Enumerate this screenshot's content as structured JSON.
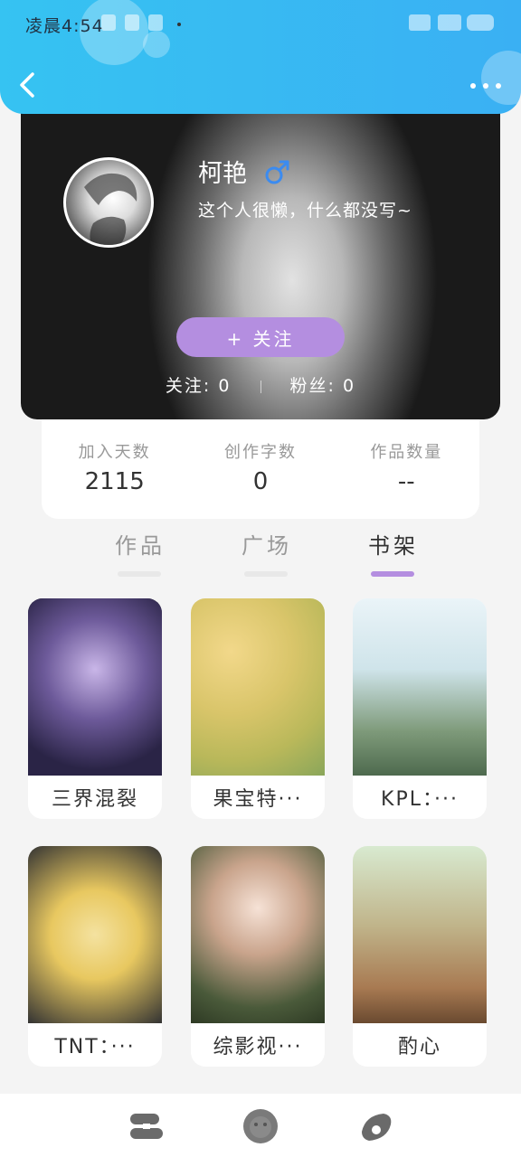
{
  "status_bar": {
    "time": "凌晨4:54"
  },
  "header": {
    "back_icon": "chevron-left-icon",
    "more_icon": "more-dots-icon"
  },
  "profile": {
    "username": "柯艳",
    "gender_icon": "male-icon",
    "bio": "这个人很懒，什么都没写~",
    "follow_button": "+ 关注",
    "following_label": "关注:",
    "following_count": "0",
    "followers_label": "粉丝:",
    "followers_count": "0"
  },
  "stats": [
    {
      "label": "加入天数",
      "value": "2115"
    },
    {
      "label": "创作字数",
      "value": "0"
    },
    {
      "label": "作品数量",
      "value": "--"
    }
  ],
  "tabs": [
    {
      "label": "作品",
      "active": false
    },
    {
      "label": "广场",
      "active": false
    },
    {
      "label": "书架",
      "active": true
    }
  ],
  "books": [
    {
      "title": "三界混裂"
    },
    {
      "title": "果宝特···"
    },
    {
      "title": "KPL：···"
    },
    {
      "title": "TNT：···"
    },
    {
      "title": "综影视···"
    },
    {
      "title": "酌心"
    }
  ],
  "bottom_nav": [
    {
      "icon": "bookshelf-icon"
    },
    {
      "icon": "lion-icon"
    },
    {
      "icon": "profile-icon"
    }
  ],
  "colors": {
    "header": "#36c3f2",
    "accent": "#b48ee0"
  }
}
